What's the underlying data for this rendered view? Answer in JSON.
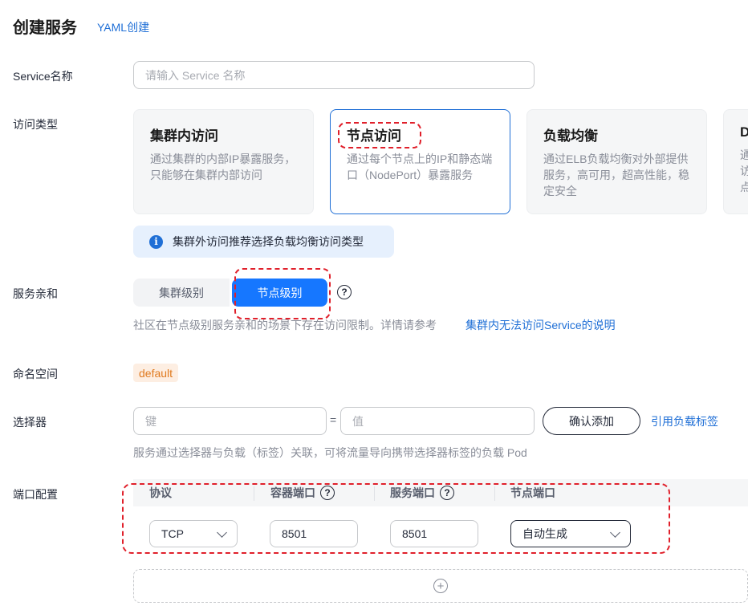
{
  "header": {
    "title": "创建服务",
    "yaml_link": "YAML创建"
  },
  "service_name": {
    "label": "Service名称",
    "placeholder": "请输入 Service 名称"
  },
  "access_type": {
    "label": "访问类型",
    "cards": [
      {
        "title": "集群内访问",
        "desc": "通过集群的内部IP暴露服务，只能够在集群内部访问"
      },
      {
        "title": "节点访问",
        "desc": "通过每个节点上的IP和静态端口（NodePort）暴露服务"
      },
      {
        "title": "负载均衡",
        "desc": "通过ELB负载均衡对外部提供服务，高可用，超高性能，稳定安全"
      },
      {
        "title": "D",
        "desc": "通访点"
      }
    ],
    "selected": "节点访问",
    "info": "集群外访问推荐选择负载均衡访问类型"
  },
  "affinity": {
    "label": "服务亲和",
    "options": [
      "集群级别",
      "节点级别"
    ],
    "selected": "节点级别",
    "hint": "社区在节点级别服务亲和的场景下存在访问限制。详情请参考",
    "hint_link": "集群内无法访问Service的说明"
  },
  "namespace": {
    "label": "命名空间",
    "value": "default"
  },
  "selector": {
    "label": "选择器",
    "key_placeholder": "键",
    "equals": "=",
    "value_placeholder": "值",
    "confirm_button": "确认添加",
    "ref_link": "引用负载标签",
    "hint": "服务通过选择器与负载（标签）关联，可将流量导向携带选择器标签的负载 Pod"
  },
  "ports": {
    "label": "端口配置",
    "headers": [
      "协议",
      "容器端口",
      "服务端口",
      "节点端口"
    ],
    "row": {
      "protocol": "TCP",
      "container_port": "8501",
      "service_port": "8501",
      "node_port": "自动生成"
    }
  },
  "help_glyph": "?",
  "plus_glyph": "+",
  "info_glyph": "i",
  "colors": {
    "accent": "#1677ff",
    "link": "#1f6fd6",
    "annotation": "#e0202b",
    "tag_text": "#e07a1f"
  }
}
